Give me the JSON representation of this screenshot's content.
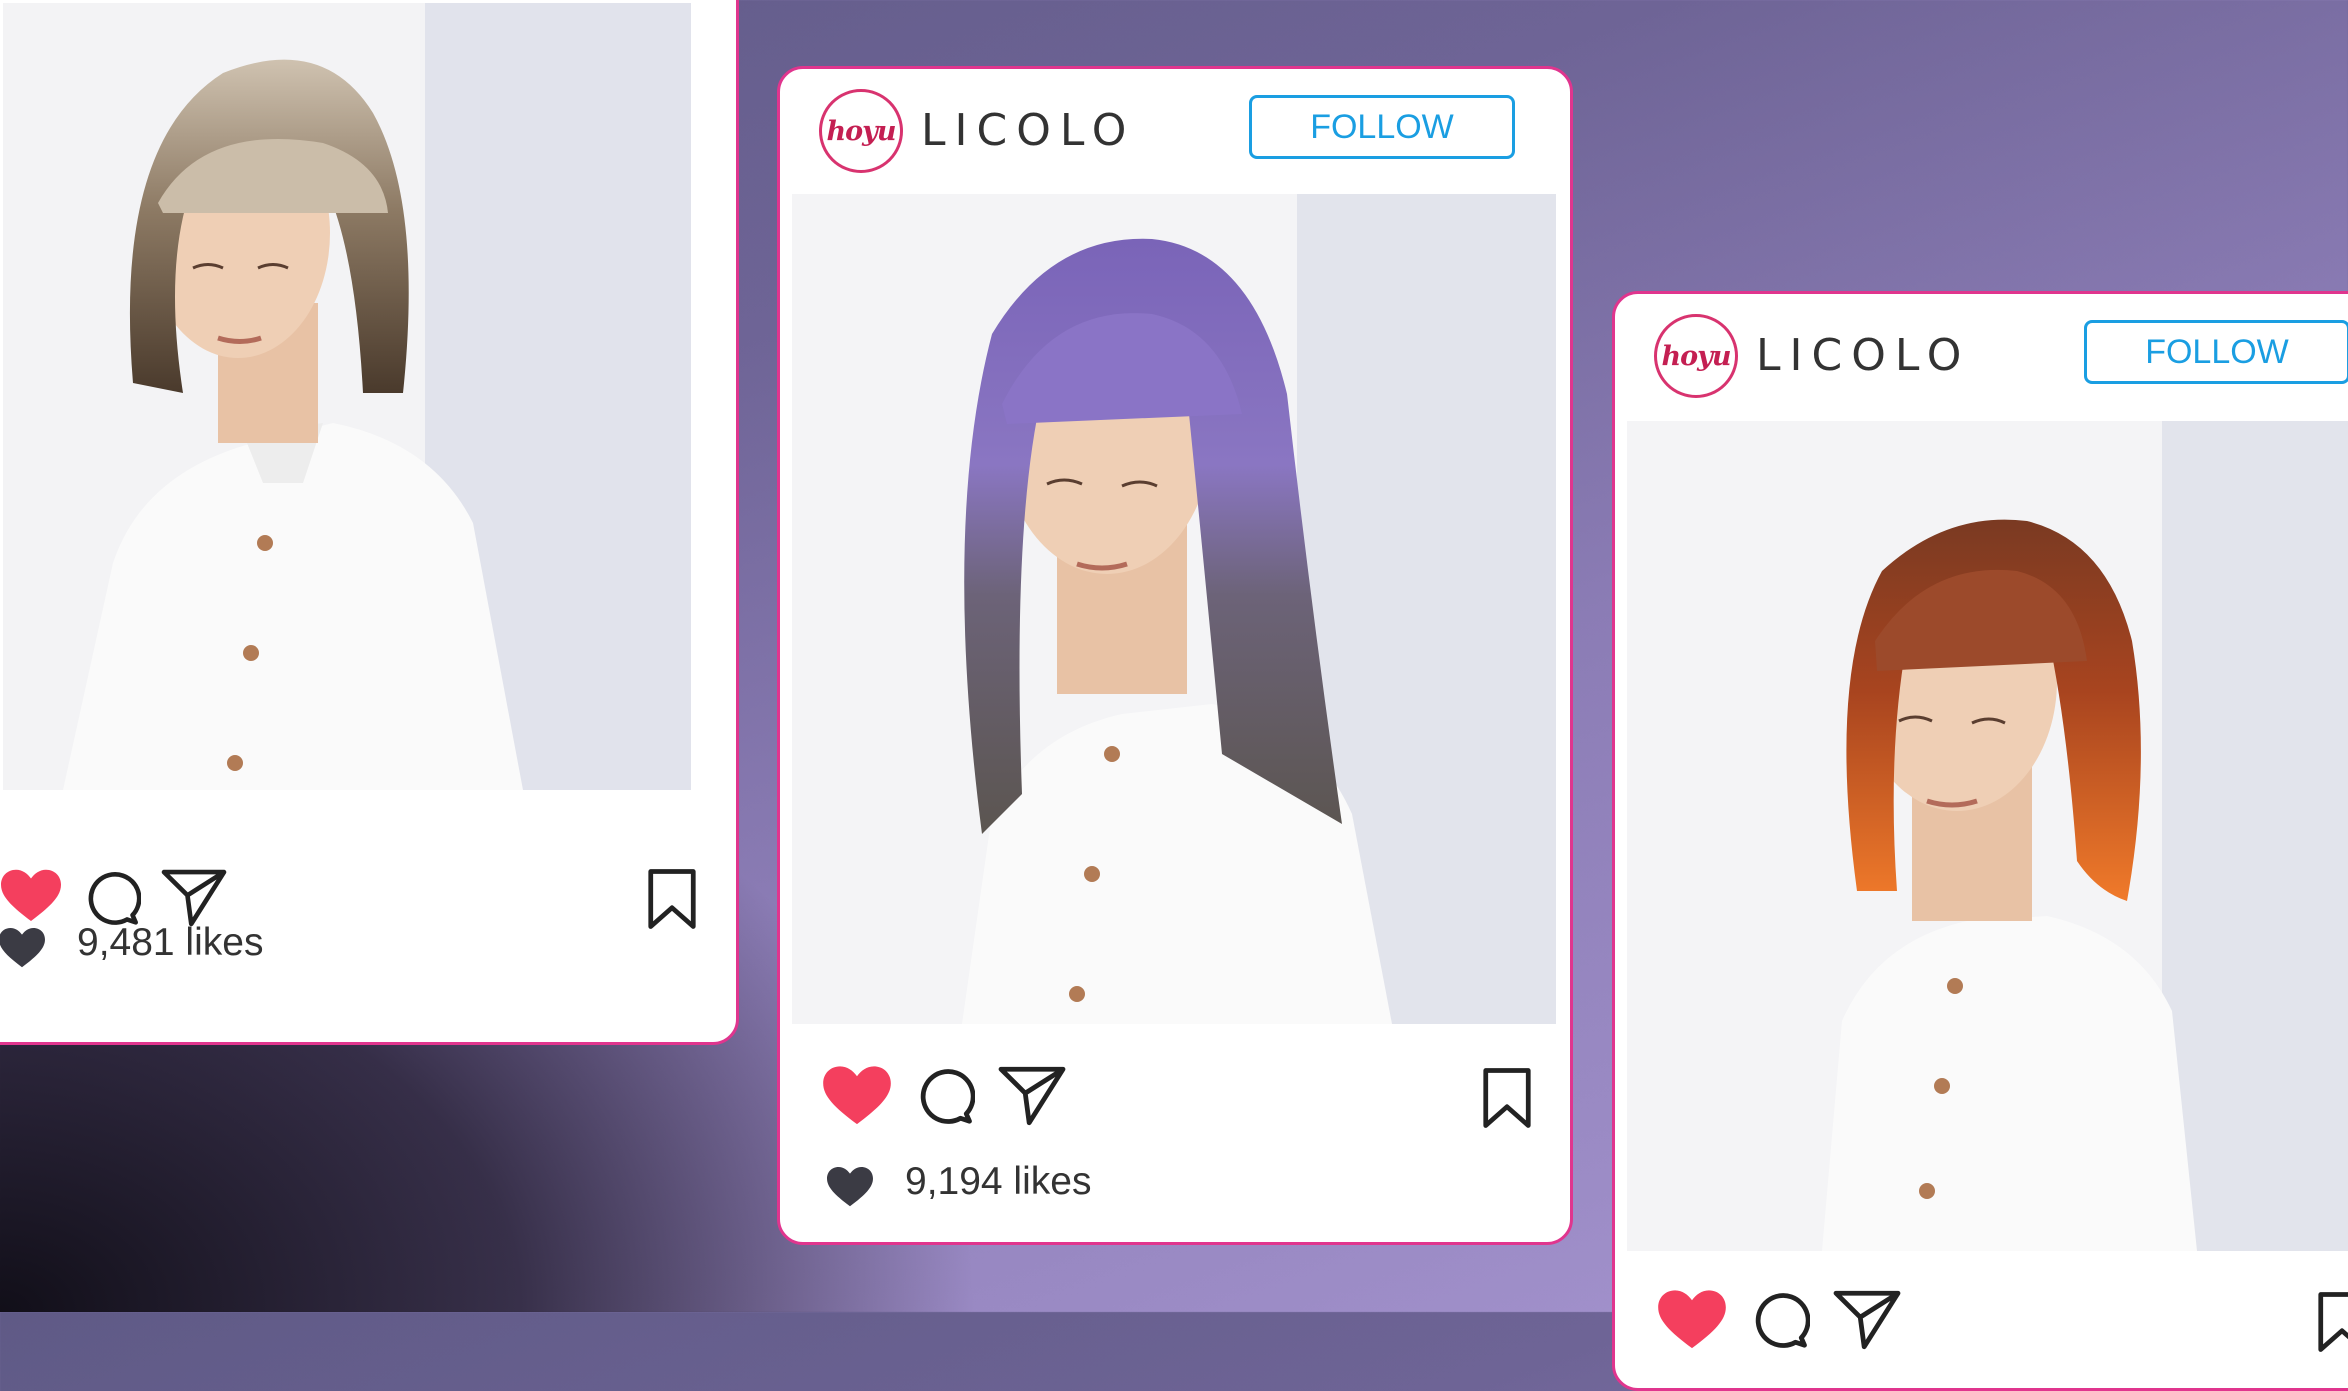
{
  "brand": {
    "logo_text": "hoyu",
    "name": "LICOLO",
    "follow_label": "FOLLOW"
  },
  "posts": [
    {
      "likes_text": "9,481 likes",
      "hair_color": "#8d7a64",
      "hair_tip_color": "#4a3a2c"
    },
    {
      "likes_text": "9,194 likes",
      "hair_color": "#7a64b8",
      "hair_tip_color": "#5b5550"
    },
    {
      "likes_text": "",
      "hair_color": "#a8441f",
      "hair_tip_color": "#f07a2a"
    }
  ],
  "colors": {
    "accent_border": "#e0358e",
    "follow_blue": "#1a9ee2",
    "like_red": "#f43f5e"
  }
}
